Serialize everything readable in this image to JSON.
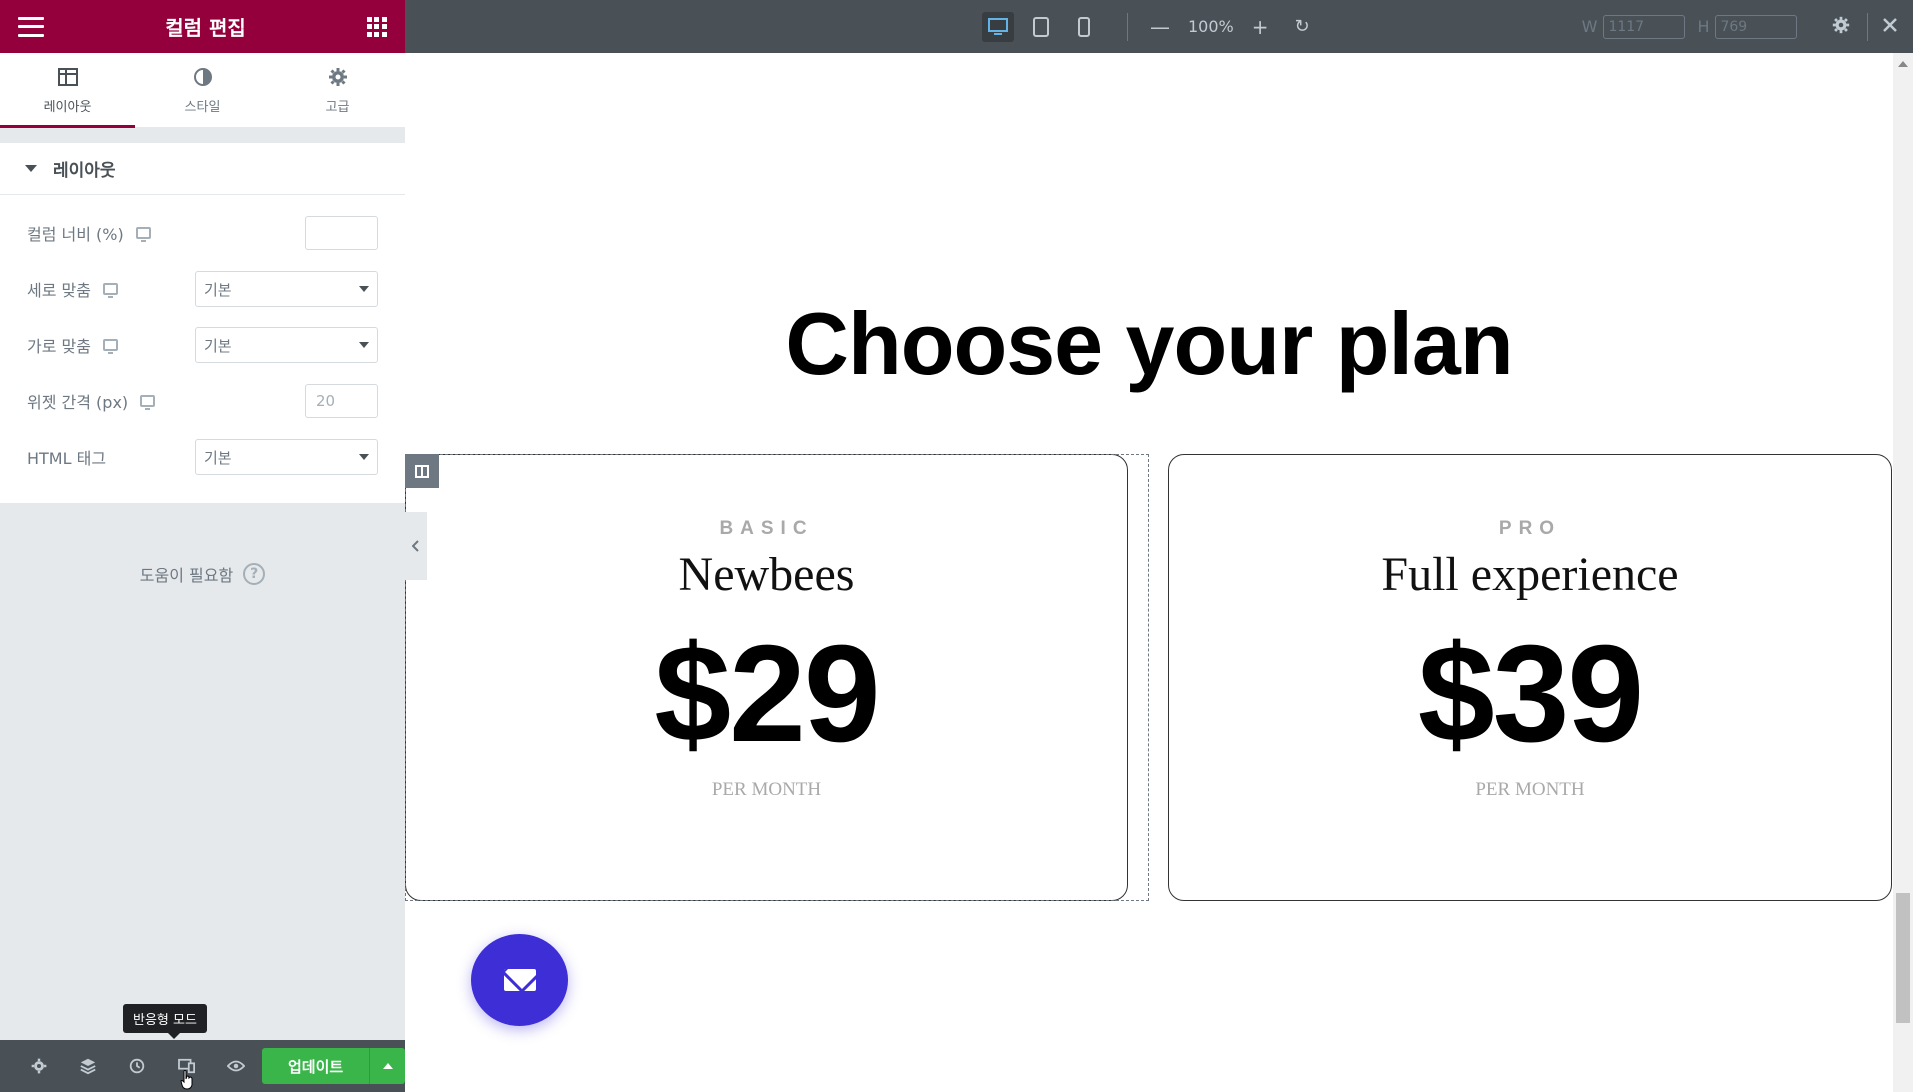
{
  "panel": {
    "title": "컬럼 편집",
    "tabs": [
      {
        "label": "레이아웃",
        "icon": "layout-icon",
        "active": true
      },
      {
        "label": "스타일",
        "icon": "contrast-icon",
        "active": false
      },
      {
        "label": "고급",
        "icon": "gear-icon",
        "active": false
      }
    ],
    "section_title": "레이아웃",
    "controls": {
      "column_width": {
        "label": "컬럼 너비 (%)",
        "value": ""
      },
      "vertical_align": {
        "label": "세로 맞춤",
        "value": "기본"
      },
      "horizontal_align": {
        "label": "가로 맞춤",
        "value": "기본"
      },
      "widget_spacing": {
        "label": "위젯 간격 (px)",
        "placeholder": "20"
      },
      "html_tag": {
        "label": "HTML 태그",
        "value": "기본"
      }
    },
    "help_text": "도움이 필요함",
    "help_icon": "?",
    "footer": {
      "update_label": "업데이트",
      "tooltip": "반응형 모드"
    }
  },
  "topbar": {
    "zoom": "100%",
    "width_label": "W",
    "width_value": "1117",
    "height_label": "H",
    "height_value": "769"
  },
  "page": {
    "headline": "Choose your plan",
    "plans": [
      {
        "tier": "BASIC",
        "name": "Newbees",
        "price": "$29",
        "period": "PER MONTH"
      },
      {
        "tier": "PRO",
        "name": "Full experience",
        "price": "$39",
        "period": "PER MONTH"
      }
    ]
  },
  "colors": {
    "brand": "#93003c",
    "update_green": "#39b54a",
    "fab_purple": "#3d2ed6",
    "topbar": "#495157"
  }
}
